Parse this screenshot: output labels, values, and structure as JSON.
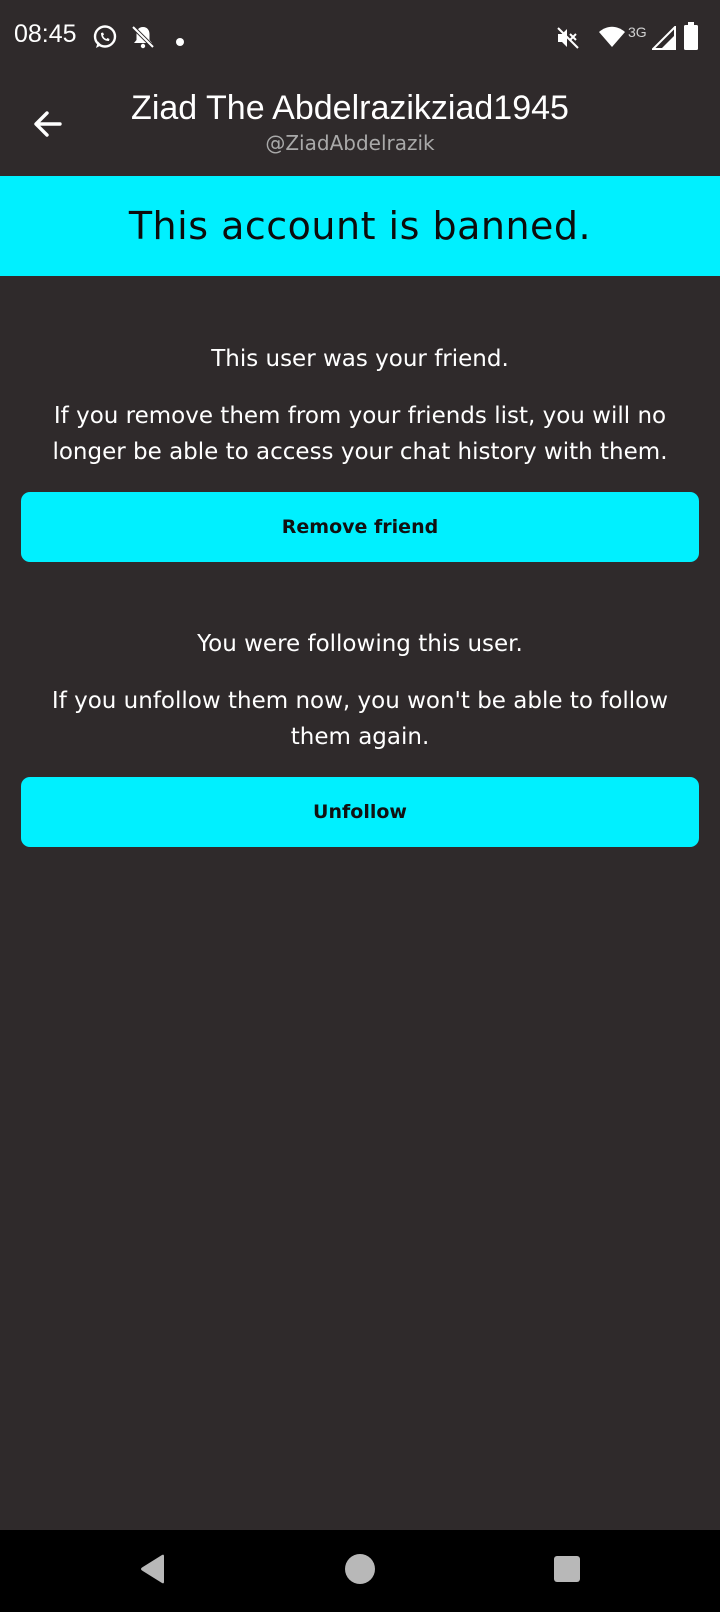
{
  "status_bar": {
    "time": "08:45",
    "network": "3G",
    "icons": [
      "whatsapp-icon",
      "notifications-off-icon",
      "dot-icon",
      "mute-icon",
      "wifi-icon",
      "signal-icon",
      "battery-icon"
    ]
  },
  "app_bar": {
    "title": "Ziad The Abdelrazikziad1945",
    "subtitle": "@ZiadAbdelrazik",
    "back_icon": "arrow-left-icon"
  },
  "banner": {
    "text": "This account is banned."
  },
  "friend_section": {
    "headline": "This user was your friend.",
    "body": "If you remove them from your friends list, you will no longer be able to access your chat history with them.",
    "button_label": "Remove friend"
  },
  "follow_section": {
    "headline": "You were following this user.",
    "body": "If you unfollow them now, you won't be able to follow them again.",
    "button_label": "Unfollow"
  },
  "colors": {
    "background": "#2f2a2b",
    "accent": "#00f0ff",
    "nav_bar": "#000000"
  },
  "nav_bar": {
    "icons": [
      "nav-back-icon",
      "nav-home-icon",
      "nav-recents-icon"
    ]
  }
}
